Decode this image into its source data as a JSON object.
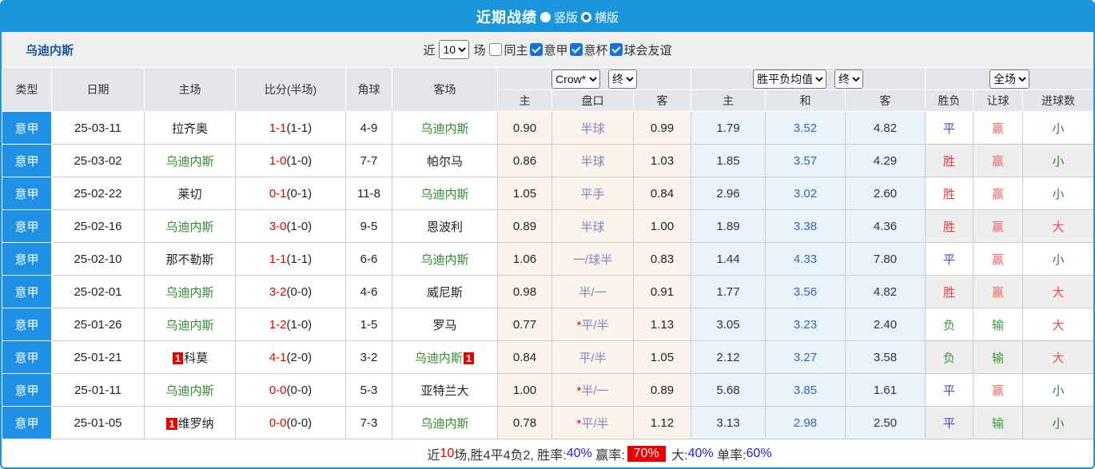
{
  "titlebar": {
    "title": "近期战绩",
    "radios": [
      {
        "label": "竖版",
        "checked": false
      },
      {
        "label": "横版",
        "checked": true
      }
    ]
  },
  "filter": {
    "team": "乌迪内斯",
    "near_label": "近",
    "count_value": "10",
    "games_label": "场",
    "checkboxes": [
      {
        "label": "同主",
        "checked": false
      },
      {
        "label": "意甲",
        "checked": true
      },
      {
        "label": "意杯",
        "checked": true
      },
      {
        "label": "球会友谊",
        "checked": true
      }
    ]
  },
  "table": {
    "selects": {
      "bookmaker": "Crow*",
      "bookmaker_state": "终",
      "europe": "胜平负均值",
      "europe_state": "终",
      "scope": "全场"
    },
    "columns": [
      "类型",
      "日期",
      "主场",
      "比分(半场)",
      "角球",
      "客场"
    ],
    "subcolumns": [
      "主",
      "盘口",
      "客",
      "主",
      "和",
      "客",
      "胜负",
      "让球",
      "进球数"
    ],
    "rows": [
      {
        "league": "意甲",
        "date": "25-03-11",
        "home": {
          "name": "拉齐奥",
          "green": false,
          "badge": null
        },
        "score": {
          "full": "1-1",
          "half": "(1-1)"
        },
        "corner": "4-9",
        "away": {
          "name": "乌迪内斯",
          "green": true,
          "badge": null
        },
        "asia": {
          "home": "0.90",
          "star": false,
          "handicap": "半球",
          "away": "0.99"
        },
        "euro": {
          "home": "1.79",
          "draw": "3.52",
          "away": "4.82"
        },
        "result": {
          "text": "平",
          "color": "draw_blue"
        },
        "cover": {
          "text": "赢",
          "color": "cover_red"
        },
        "goals": {
          "text": "小",
          "color": "small_green"
        },
        "shaded": false
      },
      {
        "league": "意甲",
        "date": "25-03-02",
        "home": {
          "name": "乌迪内斯",
          "green": true,
          "badge": null
        },
        "score": {
          "full": "1-0",
          "half": "(1-0)"
        },
        "corner": "7-7",
        "away": {
          "name": "帕尔马",
          "green": false,
          "badge": null
        },
        "asia": {
          "home": "0.86",
          "star": false,
          "handicap": "半球",
          "away": "1.03"
        },
        "euro": {
          "home": "1.85",
          "draw": "3.57",
          "away": "4.29"
        },
        "result": {
          "text": "胜",
          "color": "win_red"
        },
        "cover": {
          "text": "赢",
          "color": "cover_red"
        },
        "goals": {
          "text": "小",
          "color": "small_green"
        },
        "shaded": true
      },
      {
        "league": "意甲",
        "date": "25-02-22",
        "home": {
          "name": "莱切",
          "green": false,
          "badge": null
        },
        "score": {
          "full": "0-1",
          "half": "(0-1)"
        },
        "corner": "11-8",
        "away": {
          "name": "乌迪内斯",
          "green": true,
          "badge": null
        },
        "asia": {
          "home": "1.05",
          "star": false,
          "handicap": "平手",
          "away": "0.84"
        },
        "euro": {
          "home": "2.96",
          "draw": "3.02",
          "away": "2.60"
        },
        "result": {
          "text": "胜",
          "color": "win_red"
        },
        "cover": {
          "text": "赢",
          "color": "cover_red"
        },
        "goals": {
          "text": "小",
          "color": "small_green"
        },
        "shaded": false
      },
      {
        "league": "意甲",
        "date": "25-02-16",
        "home": {
          "name": "乌迪内斯",
          "green": true,
          "badge": null
        },
        "score": {
          "full": "3-0",
          "half": "(1-0)"
        },
        "corner": "9-5",
        "away": {
          "name": "恩波利",
          "green": false,
          "badge": null
        },
        "asia": {
          "home": "0.89",
          "star": false,
          "handicap": "半球",
          "away": "1.00"
        },
        "euro": {
          "home": "1.89",
          "draw": "3.38",
          "away": "4.36"
        },
        "result": {
          "text": "胜",
          "color": "win_red"
        },
        "cover": {
          "text": "赢",
          "color": "cover_red"
        },
        "goals": {
          "text": "大",
          "color": "big_red"
        },
        "shaded": true
      },
      {
        "league": "意甲",
        "date": "25-02-10",
        "home": {
          "name": "那不勒斯",
          "green": false,
          "badge": null
        },
        "score": {
          "full": "1-1",
          "half": "(1-1)"
        },
        "corner": "6-6",
        "away": {
          "name": "乌迪内斯",
          "green": true,
          "badge": null
        },
        "asia": {
          "home": "1.06",
          "star": false,
          "handicap": "一/球半",
          "away": "0.83"
        },
        "euro": {
          "home": "1.44",
          "draw": "4.33",
          "away": "7.80"
        },
        "result": {
          "text": "平",
          "color": "draw_blue"
        },
        "cover": {
          "text": "赢",
          "color": "cover_red"
        },
        "goals": {
          "text": "小",
          "color": "small_green"
        },
        "shaded": false
      },
      {
        "league": "意甲",
        "date": "25-02-01",
        "home": {
          "name": "乌迪内斯",
          "green": true,
          "badge": null
        },
        "score": {
          "full": "3-2",
          "half": "(0-0)"
        },
        "corner": "4-6",
        "away": {
          "name": "威尼斯",
          "green": false,
          "badge": null
        },
        "asia": {
          "home": "0.98",
          "star": false,
          "handicap": "半/一",
          "away": "0.91"
        },
        "euro": {
          "home": "1.77",
          "draw": "3.56",
          "away": "4.82"
        },
        "result": {
          "text": "胜",
          "color": "win_red"
        },
        "cover": {
          "text": "赢",
          "color": "cover_red"
        },
        "goals": {
          "text": "大",
          "color": "big_red"
        },
        "shaded": true
      },
      {
        "league": "意甲",
        "date": "25-01-26",
        "home": {
          "name": "乌迪内斯",
          "green": true,
          "badge": null
        },
        "score": {
          "full": "1-2",
          "half": "(1-0)"
        },
        "corner": "1-5",
        "away": {
          "name": "罗马",
          "green": false,
          "badge": null
        },
        "asia": {
          "home": "0.77",
          "star": true,
          "handicap": "平/半",
          "away": "1.13"
        },
        "euro": {
          "home": "3.05",
          "draw": "3.23",
          "away": "2.40"
        },
        "result": {
          "text": "负",
          "color": "lose_green"
        },
        "cover": {
          "text": "输",
          "color": "lose_green"
        },
        "goals": {
          "text": "大",
          "color": "big_red"
        },
        "shaded": false
      },
      {
        "league": "意甲",
        "date": "25-01-21",
        "home": {
          "name": "科莫",
          "green": false,
          "badge": "1"
        },
        "score": {
          "full": "4-1",
          "half": "(2-0)"
        },
        "corner": "3-2",
        "away": {
          "name": "乌迪内斯",
          "green": true,
          "badge": "1"
        },
        "asia": {
          "home": "0.84",
          "star": false,
          "handicap": "平/半",
          "away": "1.05"
        },
        "euro": {
          "home": "2.12",
          "draw": "3.27",
          "away": "3.58"
        },
        "result": {
          "text": "负",
          "color": "lose_green"
        },
        "cover": {
          "text": "输",
          "color": "lose_green"
        },
        "goals": {
          "text": "大",
          "color": "big_red"
        },
        "shaded": true
      },
      {
        "league": "意甲",
        "date": "25-01-11",
        "home": {
          "name": "乌迪内斯",
          "green": true,
          "badge": null
        },
        "score": {
          "full": "0-0",
          "half": "(0-0)"
        },
        "corner": "5-3",
        "away": {
          "name": "亚特兰大",
          "green": false,
          "badge": null
        },
        "asia": {
          "home": "1.00",
          "star": true,
          "handicap": "半/一",
          "away": "0.89"
        },
        "euro": {
          "home": "5.68",
          "draw": "3.85",
          "away": "1.61"
        },
        "result": {
          "text": "平",
          "color": "draw_blue"
        },
        "cover": {
          "text": "赢",
          "color": "cover_red"
        },
        "goals": {
          "text": "小",
          "color": "small_green"
        },
        "shaded": false
      },
      {
        "league": "意甲",
        "date": "25-01-05",
        "home": {
          "name": "维罗纳",
          "green": false,
          "badge": "1"
        },
        "score": {
          "full": "0-0",
          "half": "(0-0)"
        },
        "corner": "7-3",
        "away": {
          "name": "乌迪内斯",
          "green": true,
          "badge": null
        },
        "asia": {
          "home": "0.78",
          "star": true,
          "handicap": "平/半",
          "away": "1.12"
        },
        "euro": {
          "home": "3.13",
          "draw": "2.98",
          "away": "2.50"
        },
        "result": {
          "text": "平",
          "color": "draw_blue"
        },
        "cover": {
          "text": "输",
          "color": "lose_green"
        },
        "goals": {
          "text": "小",
          "color": "small_green"
        },
        "shaded": true
      }
    ]
  },
  "footer": {
    "segments": [
      {
        "text": "近",
        "style": "plain"
      },
      {
        "text": "10",
        "style": "red"
      },
      {
        "text": "场,胜4平4负2, 胜率:",
        "style": "plain"
      },
      {
        "text": "40%",
        "style": "blue"
      },
      {
        "text": " 赢率:",
        "style": "plain"
      },
      {
        "text": "70%",
        "style": "redblock"
      },
      {
        "text": " 大:",
        "style": "plain"
      },
      {
        "text": "40%",
        "style": "blue"
      },
      {
        "text": " 单率:",
        "style": "plain"
      },
      {
        "text": "60%",
        "style": "blue"
      }
    ]
  },
  "colors": {
    "accent_blue": "#1b95dc",
    "league_cell_blue": "#1e90e5",
    "team_green": "#2e8b2e",
    "score_red": "#e60000",
    "handicap_purple": "#8282c2",
    "asia_odds_bg": "#faf4ec",
    "euro_odds_bg": "#e9f3f9",
    "alt_row_gray": "#eeeeee",
    "win_red": "#e23b3b",
    "draw_blue": "#4444e0",
    "lose_green": "#3a9a3a",
    "cover_red": "#f26a6a",
    "big_red": "#f04848",
    "small_green": "#2e7d32"
  }
}
